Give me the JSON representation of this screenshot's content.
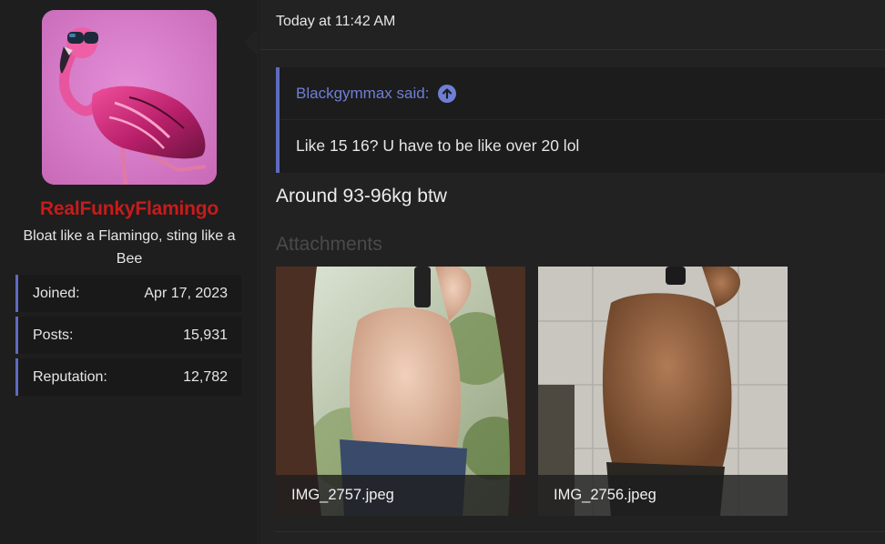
{
  "user": {
    "username": "RealFunkyFlamingo",
    "username_color": "#c81b1b",
    "title": "Bloat like a Flamingo, sting like a Bee",
    "avatar_icon": "flamingo-with-sunglasses-avatar",
    "stats": [
      {
        "label": "Joined:",
        "value": "Apr 17, 2023"
      },
      {
        "label": "Posts:",
        "value": "15,931"
      },
      {
        "label": "Reputation:",
        "value": "12,782"
      }
    ]
  },
  "post": {
    "timestamp": "Today at 11:42 AM",
    "quote": {
      "author_said": "Blackgymmax said:",
      "jump_icon": "arrow-up-circle-icon",
      "text": "Like 15 16? U have to be like over 20 lol"
    },
    "body": "Around 93-96kg btw",
    "attachments_label": "Attachments",
    "attachments": [
      {
        "filename": "IMG_2757.jpeg"
      },
      {
        "filename": "IMG_2756.jpeg"
      }
    ]
  },
  "colors": {
    "accent": "#5e6bbf",
    "quote_link": "#6e7fd6",
    "background": "#1c1c1c",
    "message_background": "#222222"
  }
}
